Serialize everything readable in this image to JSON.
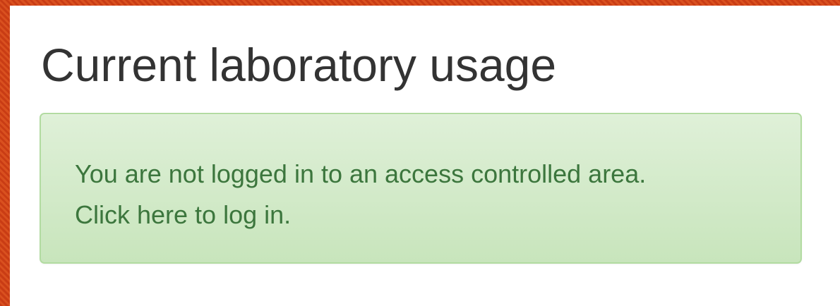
{
  "page": {
    "title": "Current laboratory usage"
  },
  "alert": {
    "message": "You are not logged in to an access controlled area.",
    "link_text": "Click here to log in."
  },
  "colors": {
    "accent_orange": "#c93c14",
    "alert_background": "#dff0d8",
    "alert_border": "#b2dba1",
    "alert_text": "#3c763d",
    "title_text": "#333333"
  }
}
